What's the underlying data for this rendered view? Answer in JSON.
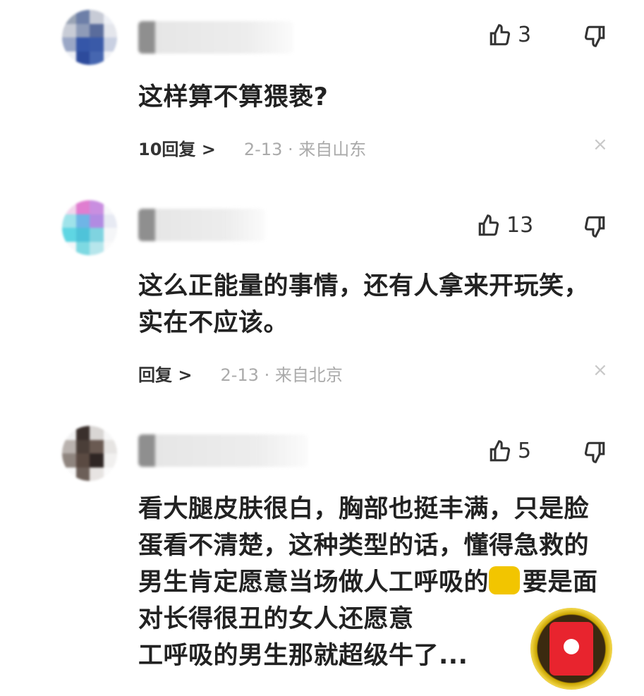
{
  "comments": [
    {
      "likes": "3",
      "text": "这样算不算猥亵?",
      "reply_label": "10回复 >",
      "meta": "2-13 · 来自山东",
      "close": "×"
    },
    {
      "likes": "13",
      "text": "这么正能量的事情，还有人拿来开玩笑，实在不应该。",
      "reply_label": "回复 >",
      "meta": "2-13 · 来自北京",
      "close": "×"
    },
    {
      "likes": "5",
      "text_part1": "看大腿皮肤很白，胸部也挺丰满，只是脸蛋看不清楚，这种类型的话，懂得急救的男生肯定愿意当场做人工呼吸的",
      "text_part2": "要是面对长得很丑的女人还愿意",
      "text_part3": "工呼吸的男生那就超级牛了..."
    }
  ],
  "icons": {
    "like": "thumbs-up-icon",
    "dislike": "thumbs-down-icon",
    "emoji": "emoji-icon",
    "red_packet": "red-packet-icon"
  },
  "colors": {
    "accent": "#e8242e",
    "text": "#222222",
    "meta": "#999999"
  }
}
